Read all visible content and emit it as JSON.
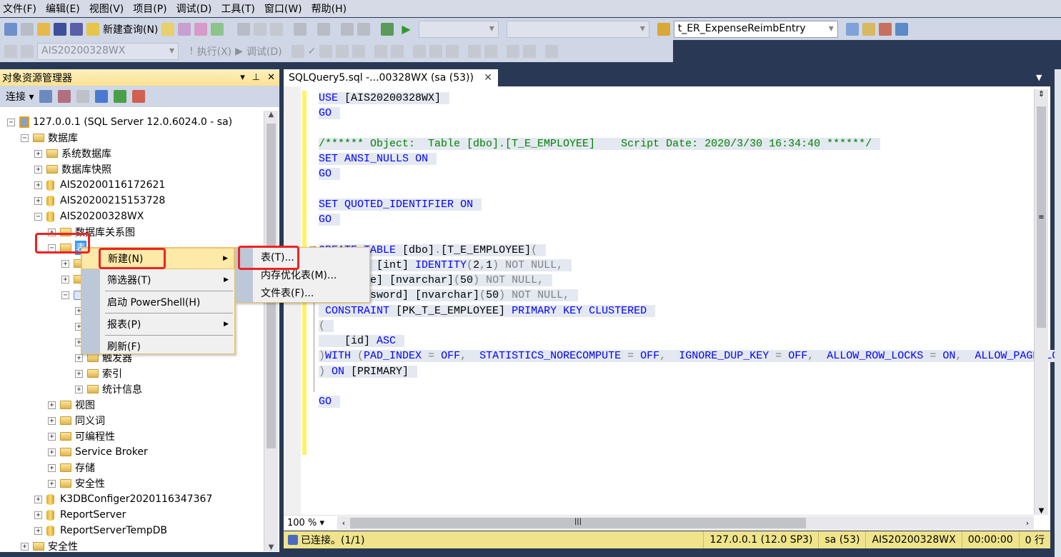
{
  "menubar": [
    "文件(F)",
    "编辑(E)",
    "视图(V)",
    "项目(P)",
    "调试(D)",
    "工具(T)",
    "窗口(W)",
    "帮助(H)"
  ],
  "toolbar": {
    "new_query": "新建查询(N)",
    "object_combo": "t_ER_ExpenseReimbEntry",
    "db_combo": "AIS20200328WX",
    "execute": "执行(X)",
    "debug": "调试(D)"
  },
  "object_explorer": {
    "title": "对象资源管理器",
    "connect": "连接",
    "tree": [
      {
        "label": "127.0.0.1 (SQL Server 12.0.6024.0 - sa)",
        "level": 0,
        "exp": "-",
        "icon": "server"
      },
      {
        "label": "数据库",
        "level": 1,
        "exp": "-",
        "icon": "folder"
      },
      {
        "label": "系统数据库",
        "level": 2,
        "exp": "+",
        "icon": "folder"
      },
      {
        "label": "数据库快照",
        "level": 2,
        "exp": "+",
        "icon": "folder"
      },
      {
        "label": "AIS20200116172621",
        "level": 2,
        "exp": "+",
        "icon": "db"
      },
      {
        "label": "AIS20200215153728",
        "level": 2,
        "exp": "+",
        "icon": "db"
      },
      {
        "label": "AIS20200328WX",
        "level": 2,
        "exp": "-",
        "icon": "db"
      },
      {
        "label": "数据库关系图",
        "level": 3,
        "exp": "+",
        "icon": "folder"
      },
      {
        "label": "表",
        "level": 3,
        "exp": "-",
        "icon": "folder",
        "selected": true
      },
      {
        "label": "",
        "level": 4,
        "exp": "+",
        "icon": "folder"
      },
      {
        "label": "",
        "level": 4,
        "exp": "+",
        "icon": "folder"
      },
      {
        "label": "",
        "level": 4,
        "exp": "-",
        "icon": "table"
      },
      {
        "label": "",
        "level": 5,
        "exp": "+",
        "icon": "folder"
      },
      {
        "label": "",
        "level": 5,
        "exp": "+",
        "icon": "folder"
      },
      {
        "label": "",
        "level": 5,
        "exp": "+",
        "icon": "folder"
      },
      {
        "label": "触发器",
        "level": 5,
        "exp": "+",
        "icon": "folder"
      },
      {
        "label": "索引",
        "level": 5,
        "exp": "+",
        "icon": "folder"
      },
      {
        "label": "统计信息",
        "level": 5,
        "exp": "+",
        "icon": "folder"
      },
      {
        "label": "视图",
        "level": 3,
        "exp": "+",
        "icon": "folder"
      },
      {
        "label": "同义词",
        "level": 3,
        "exp": "+",
        "icon": "folder"
      },
      {
        "label": "可编程性",
        "level": 3,
        "exp": "+",
        "icon": "folder"
      },
      {
        "label": "Service Broker",
        "level": 3,
        "exp": "+",
        "icon": "folder"
      },
      {
        "label": "存储",
        "level": 3,
        "exp": "+",
        "icon": "folder"
      },
      {
        "label": "安全性",
        "level": 3,
        "exp": "+",
        "icon": "folder"
      },
      {
        "label": "K3DBConfiger2020116347367",
        "level": 2,
        "exp": "+",
        "icon": "db"
      },
      {
        "label": "ReportServer",
        "level": 2,
        "exp": "+",
        "icon": "db"
      },
      {
        "label": "ReportServerTempDB",
        "level": 2,
        "exp": "+",
        "icon": "db"
      },
      {
        "label": "安全性",
        "level": 1,
        "exp": "+",
        "icon": "folder"
      }
    ]
  },
  "context_menu": {
    "items": [
      "新建(N)",
      "筛选器(T)",
      "启动 PowerShell(H)",
      "报表(P)",
      "刷新(F)"
    ],
    "submenu": [
      "表(T)...",
      "内存优化表(M)...",
      "文件表(F)..."
    ]
  },
  "editor": {
    "tab": "SQLQuery5.sql -...00328WX (sa (53))",
    "zoom": "100 %",
    "lines": [
      [
        [
          "USE",
          "kw"
        ],
        [
          " [AIS20200328WX]",
          "tx"
        ]
      ],
      [
        [
          "GO",
          "kw"
        ]
      ],
      [],
      [
        [
          "/****** Object:  Table [dbo].[T_E_EMPLOYEE]    Script Date: 2020/3/30 16:34:40 ******/",
          "cm"
        ]
      ],
      [
        [
          "SET",
          "kw"
        ],
        [
          " ",
          "tx"
        ],
        [
          "ANSI_NULLS",
          "kw"
        ],
        [
          " ",
          "tx"
        ],
        [
          "ON",
          "kw"
        ]
      ],
      [
        [
          "GO",
          "kw"
        ]
      ],
      [],
      [
        [
          "SET",
          "kw"
        ],
        [
          " ",
          "tx"
        ],
        [
          "QUOTED_IDENTIFIER",
          "kw"
        ],
        [
          " ",
          "tx"
        ],
        [
          "ON",
          "kw"
        ]
      ],
      [
        [
          "GO",
          "kw"
        ]
      ],
      [],
      [
        [
          "CREATE",
          "kw"
        ],
        [
          " ",
          "tx"
        ],
        [
          "TABLE",
          "kw"
        ],
        [
          " [dbo]",
          "tx"
        ],
        [
          ".",
          "gy"
        ],
        [
          "[T_E_EMPLOYEE]",
          "tx"
        ],
        [
          "(",
          "gy"
        ]
      ],
      [
        [
          "\t[id] [int] ",
          "tx"
        ],
        [
          "IDENTITY",
          "kw"
        ],
        [
          "(",
          "gy"
        ],
        [
          "2",
          "tx"
        ],
        [
          ",",
          "gy"
        ],
        [
          "1",
          "tx"
        ],
        [
          ") NOT NULL,",
          "gy"
        ]
      ],
      [
        [
          "\t[name] [nvarchar]",
          "tx"
        ],
        [
          "(",
          "gy"
        ],
        [
          "50",
          "tx"
        ],
        [
          ") NOT NULL,",
          "gy"
        ]
      ],
      [
        [
          "\t[password] [nvarchar]",
          "tx"
        ],
        [
          "(",
          "gy"
        ],
        [
          "50",
          "tx"
        ],
        [
          ") NOT NULL,",
          "gy"
        ]
      ],
      [
        [
          " ",
          "tx"
        ],
        [
          "CONSTRAINT",
          "kw"
        ],
        [
          " [PK_T_E_EMPLOYEE] ",
          "tx"
        ],
        [
          "PRIMARY KEY CLUSTERED",
          "kw"
        ]
      ],
      [
        [
          "(",
          "gy"
        ]
      ],
      [
        [
          "\t[id] ",
          "tx"
        ],
        [
          "ASC",
          "kw"
        ]
      ],
      [
        [
          ")",
          "gy"
        ],
        [
          "WITH",
          "kw"
        ],
        [
          " (",
          "gy"
        ],
        [
          "PAD_INDEX",
          "kw"
        ],
        [
          " = ",
          "gy"
        ],
        [
          "OFF",
          "kw"
        ],
        [
          ",  ",
          "gy"
        ],
        [
          "STATISTICS_NORECOMPUTE",
          "kw"
        ],
        [
          " = ",
          "gy"
        ],
        [
          "OFF",
          "kw"
        ],
        [
          ",  ",
          "gy"
        ],
        [
          "IGNORE_DUP_KEY",
          "kw"
        ],
        [
          " = ",
          "gy"
        ],
        [
          "OFF",
          "kw"
        ],
        [
          ",  ",
          "gy"
        ],
        [
          "ALLOW_ROW_LOCKS",
          "kw"
        ],
        [
          " = ",
          "gy"
        ],
        [
          "ON",
          "kw"
        ],
        [
          ",  ",
          "gy"
        ],
        [
          "ALLOW_PAGE_LO",
          "kw"
        ]
      ],
      [
        [
          ")",
          "gy"
        ],
        [
          " ",
          "tx"
        ],
        [
          "ON",
          "kw"
        ],
        [
          " [PRIMARY]",
          "tx"
        ]
      ],
      [],
      [
        [
          "GO",
          "kw"
        ]
      ]
    ]
  },
  "status": {
    "connected": "已连接。(1/1)",
    "server": "127.0.0.1 (12.0 SP3)",
    "user": "sa (53)",
    "database": "AIS20200328WX",
    "elapsed": "00:00:00",
    "rows": "0 行"
  },
  "colors": {
    "keyword": "#0000ff",
    "comment": "#008000",
    "highlight_box": "#ee2222",
    "status_bar": "#efe48c"
  }
}
